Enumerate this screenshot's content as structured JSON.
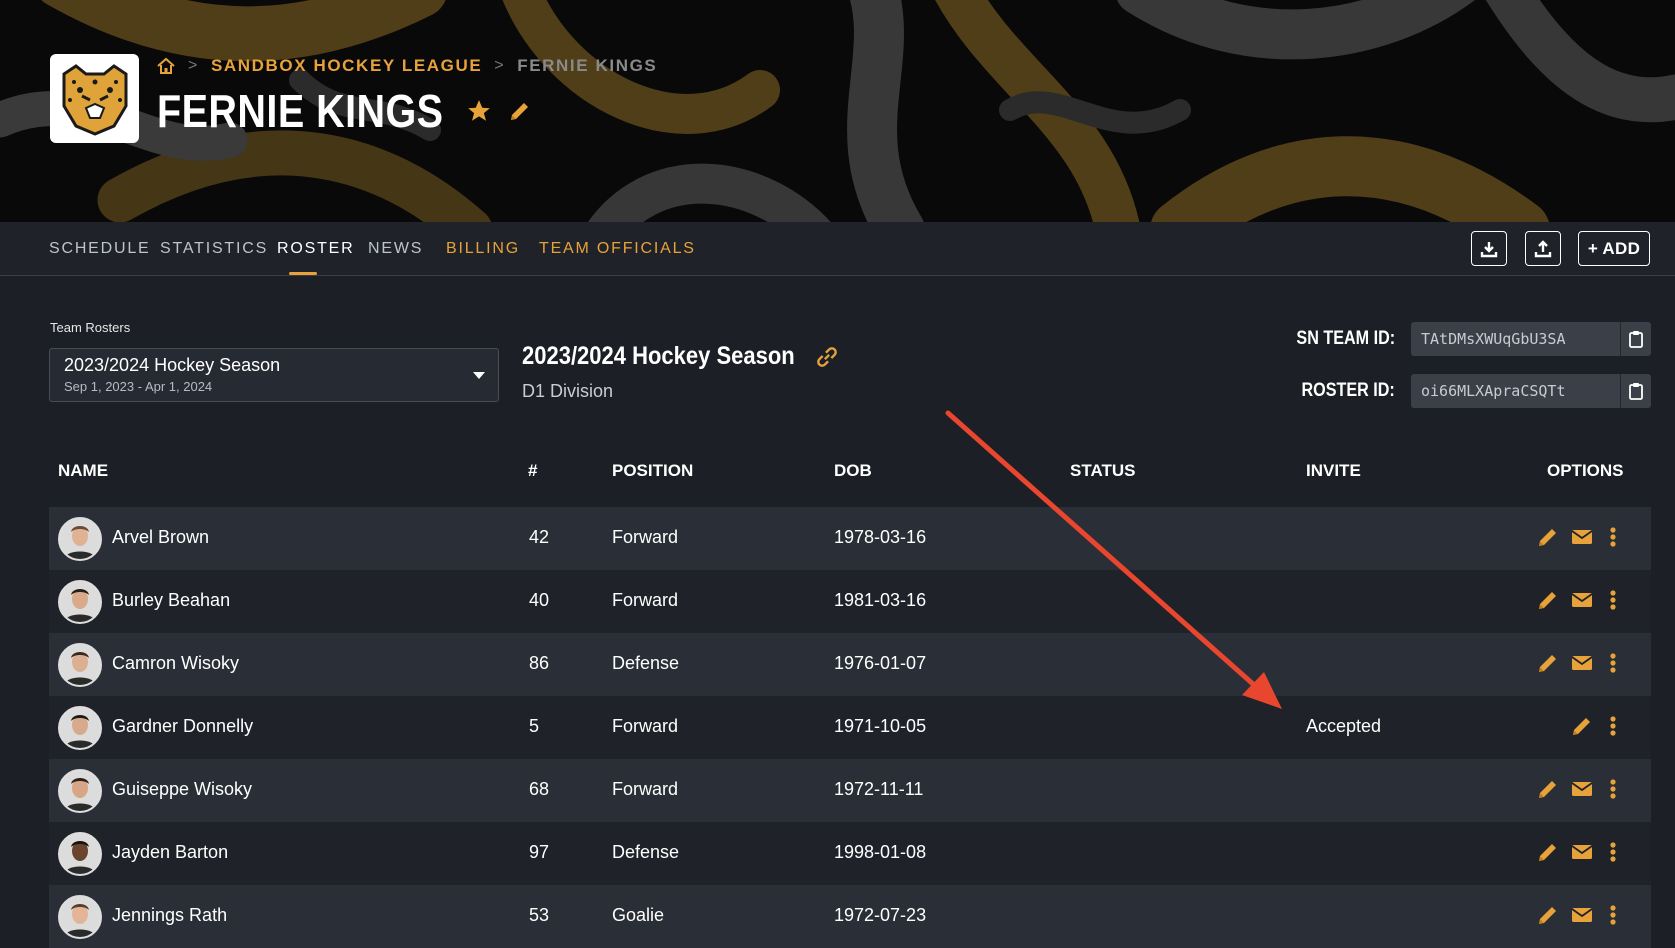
{
  "breadcrumb": {
    "league": "SANDBOX HOCKEY LEAGUE",
    "team": "FERNIE KINGS"
  },
  "team": {
    "name": "FERNIE KINGS"
  },
  "tabs": [
    {
      "label": "SCHEDULE"
    },
    {
      "label": "STATISTICS"
    },
    {
      "label": "ROSTER"
    },
    {
      "label": "NEWS"
    },
    {
      "label": "BILLING"
    },
    {
      "label": "TEAM OFFICIALS"
    }
  ],
  "toolbar": {
    "add_label": "+ ADD"
  },
  "rosters": {
    "label": "Team Rosters",
    "selected_season": "2023/2024 Hockey Season",
    "selected_dates": "Sep 1, 2023 - Apr 1, 2024",
    "season_title": "2023/2024 Hockey Season",
    "division": "D1 Division"
  },
  "ids": {
    "sn_team_label": "SN TEAM ID:",
    "sn_team_value": "TAtDMsXWUqGbU3SA",
    "roster_label": "ROSTER ID:",
    "roster_value": "oi66MLXApraCSQTt"
  },
  "table": {
    "headers": {
      "name": "NAME",
      "number": "#",
      "position": "POSITION",
      "dob": "DOB",
      "status": "STATUS",
      "invite": "INVITE",
      "options": "OPTIONS"
    },
    "rows": [
      {
        "name": "Arvel Brown",
        "number": "42",
        "position": "Forward",
        "dob": "1978-03-16",
        "status": "",
        "invite": ""
      },
      {
        "name": "Burley Beahan",
        "number": "40",
        "position": "Forward",
        "dob": "1981-03-16",
        "status": "",
        "invite": ""
      },
      {
        "name": "Camron Wisoky",
        "number": "86",
        "position": "Defense",
        "dob": "1976-01-07",
        "status": "",
        "invite": ""
      },
      {
        "name": "Gardner Donnelly",
        "number": "5",
        "position": "Forward",
        "dob": "1971-10-05",
        "status": "",
        "invite": "Accepted"
      },
      {
        "name": "Guiseppe Wisoky",
        "number": "68",
        "position": "Forward",
        "dob": "1972-11-11",
        "status": "",
        "invite": ""
      },
      {
        "name": "Jayden Barton",
        "number": "97",
        "position": "Defense",
        "dob": "1998-01-08",
        "status": "",
        "invite": ""
      },
      {
        "name": "Jennings Rath",
        "number": "53",
        "position": "Goalie",
        "dob": "1972-07-23",
        "status": "",
        "invite": ""
      }
    ]
  },
  "colors": {
    "accent": "#e8a23a",
    "background": "#1c1f26",
    "row_alt": "#2a2e36",
    "arrow": "#e8462f"
  },
  "icons": [
    "home-icon",
    "star-icon",
    "pencil-icon",
    "download-icon",
    "upload-icon",
    "link-icon",
    "clipboard-icon",
    "mail-icon",
    "kebab-icon"
  ]
}
